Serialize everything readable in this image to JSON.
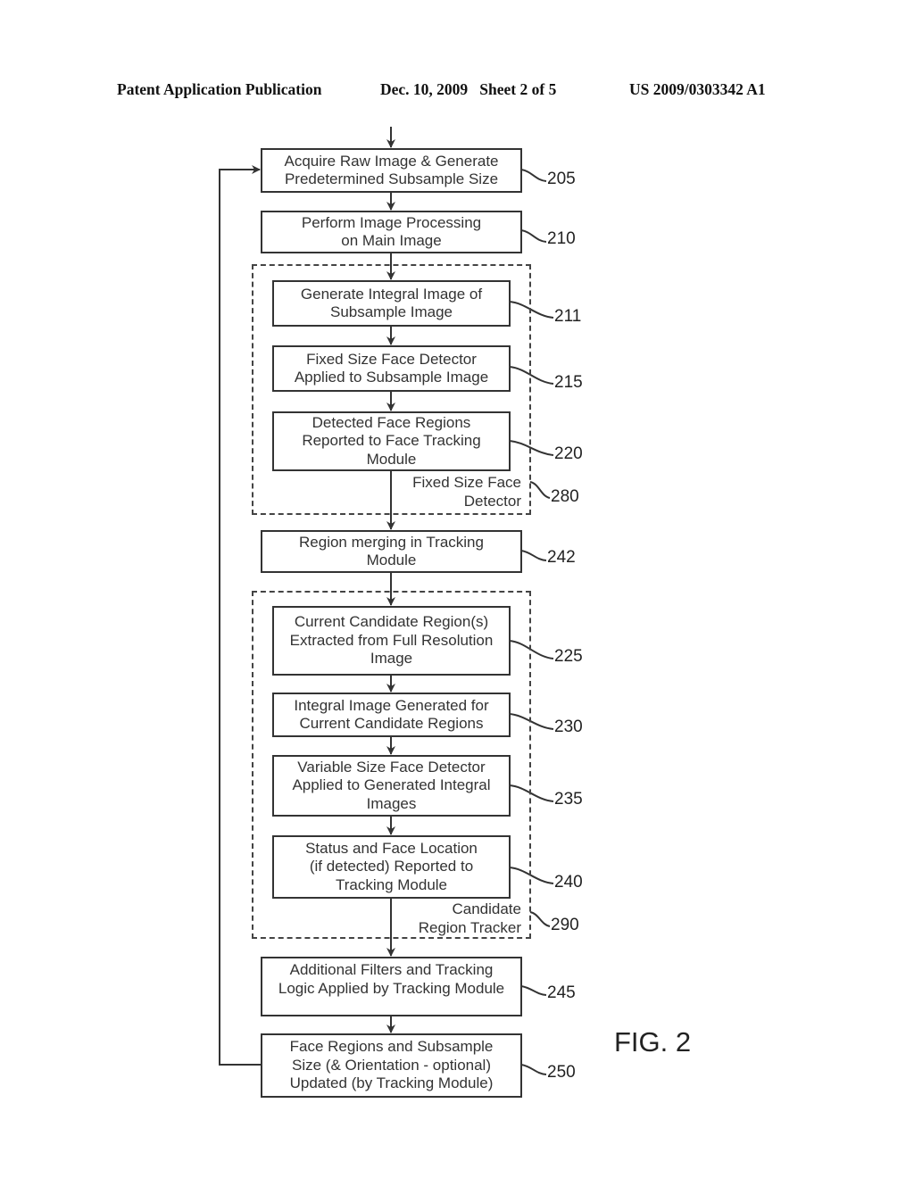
{
  "header": {
    "publication": "Patent Application Publication",
    "date_sheet": "Dec. 10, 2009   Sheet 2 of 5",
    "number": "US 2009/0303342 A1"
  },
  "figure_label": "FIG. 2",
  "groups": [
    {
      "id": "280",
      "label_line1": "Fixed Size Face",
      "label_line2": "Detector"
    },
    {
      "id": "290",
      "label_line1": "Candidate",
      "label_line2": "Region Tracker"
    }
  ],
  "steps": [
    {
      "ref": "205",
      "lines": [
        "Acquire Raw Image & Generate",
        "Predetermined Subsample Size"
      ]
    },
    {
      "ref": "210",
      "lines": [
        "Perform Image Processing",
        "on Main Image"
      ]
    },
    {
      "ref": "211",
      "lines": [
        "Generate Integral Image of",
        "Subsample Image"
      ]
    },
    {
      "ref": "215",
      "lines": [
        "Fixed Size Face Detector",
        "Applied to Subsample Image"
      ]
    },
    {
      "ref": "220",
      "lines": [
        "Detected Face Regions",
        "Reported to Face Tracking",
        "Module"
      ]
    },
    {
      "ref": "242",
      "lines": [
        "Region merging in Tracking",
        "Module"
      ]
    },
    {
      "ref": "225",
      "lines": [
        "Current Candidate Region(s)",
        "Extracted from Full Resolution",
        "Image"
      ]
    },
    {
      "ref": "230",
      "lines": [
        "Integral Image Generated for",
        "Current Candidate Regions"
      ]
    },
    {
      "ref": "235",
      "lines": [
        "Variable Size Face Detector",
        "Applied to Generated Integral",
        "Images"
      ]
    },
    {
      "ref": "240",
      "lines": [
        "Status and Face Location",
        "(if detected) Reported to",
        "Tracking Module"
      ]
    },
    {
      "ref": "245",
      "lines": [
        "Additional Filters and Tracking",
        "Logic Applied by Tracking Module"
      ]
    },
    {
      "ref": "250",
      "lines": [
        "Face Regions and Subsample",
        "Size (& Orientation - optional)",
        "Updated (by Tracking Module)"
      ]
    }
  ]
}
